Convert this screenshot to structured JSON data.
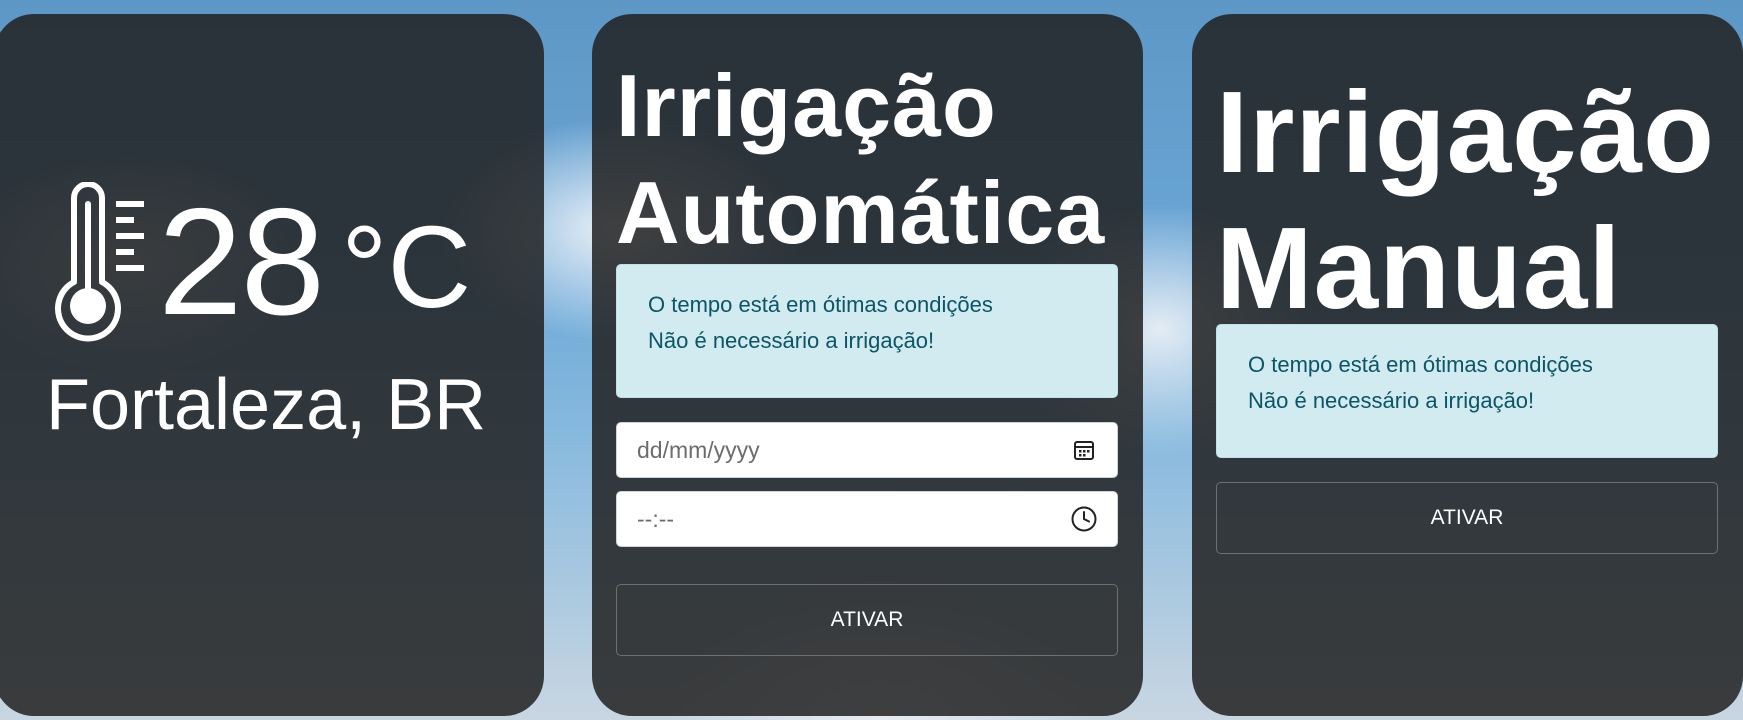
{
  "weather": {
    "temperature": "28",
    "unit": "°C",
    "location": "Fortaleza, BR",
    "icon": "thermometer-icon"
  },
  "auto_irrigation": {
    "title_line1": "Irrigação",
    "title_line2": "Automática",
    "alert_line1": "O tempo está em ótimas condições",
    "alert_line2": "Não é necessário a irrigação!",
    "date_placeholder": "dd/mm/yyyy",
    "date_icon": "calendar-icon",
    "time_placeholder": "--:--",
    "time_icon": "clock-icon",
    "button_label": "ATIVAR"
  },
  "manual_irrigation": {
    "title_line1": "Irrigação",
    "title_line2": "Manual",
    "alert_line1": "O tempo está em ótimas condições",
    "alert_line2": "Não é necessário a irrigação!",
    "button_label": "ATIVAR"
  },
  "colors": {
    "card_background": "#222222",
    "alert_background": "#d1ebf0",
    "alert_text": "#0b5566",
    "text_light": "#ffffff",
    "button_border": "#6f6f6f"
  }
}
